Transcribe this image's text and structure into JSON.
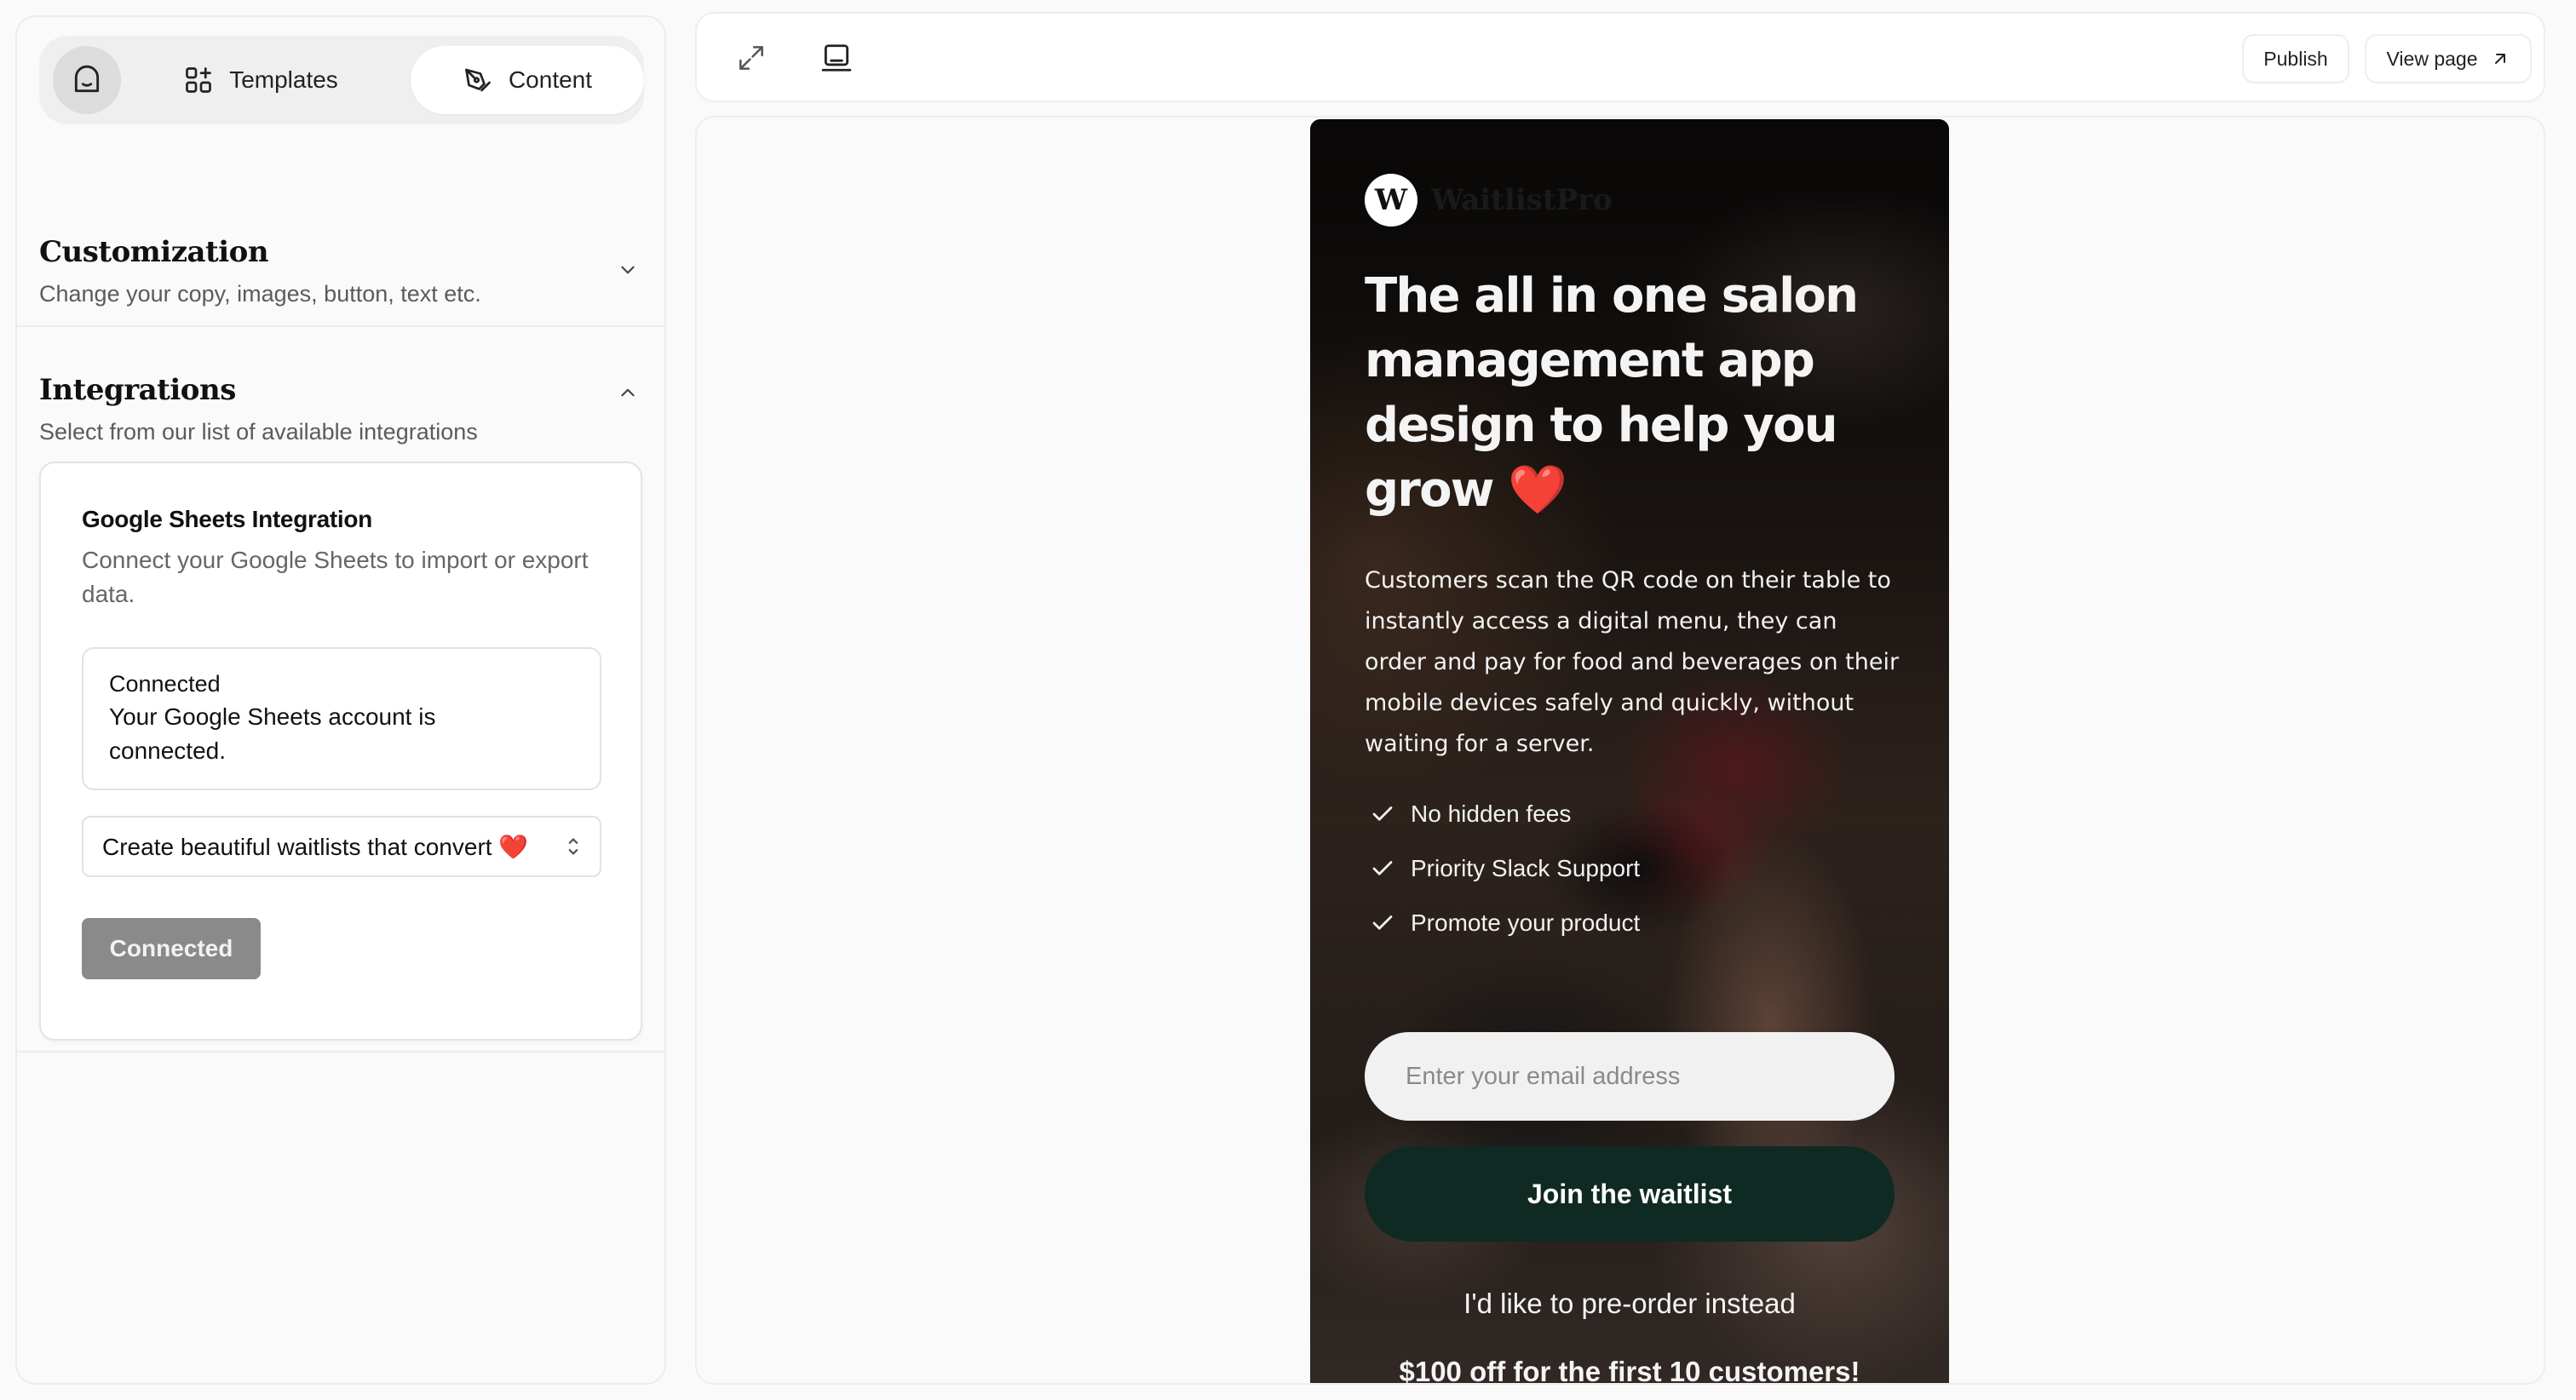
{
  "nav": {
    "templates_label": "Templates",
    "content_label": "Content"
  },
  "sections": {
    "customization": {
      "title": "Customization",
      "subtitle": "Change your copy, images, button, text etc.",
      "expanded": false
    },
    "integrations": {
      "title": "Integrations",
      "subtitle": "Select from our list of available integrations",
      "expanded": true
    }
  },
  "integration_card": {
    "title": "Google Sheets Integration",
    "description": "Connect your Google Sheets to import or export data.",
    "status_title": "Connected",
    "status_text": "Your Google Sheets account is connected.",
    "sheet_select_value": "Create beautiful waitlists that convert ❤️",
    "button_label": "Connected"
  },
  "toolbar": {
    "publish_label": "Publish",
    "view_page_label": "View page"
  },
  "preview": {
    "logo_letter": "W",
    "logo_text": "WaitlistPro",
    "headline": "The all in one salon management app design to help you grow ❤️",
    "body": "Customers scan the QR code on their table to instantly access a digital menu, they can order and pay for food and beverages on their mobile devices safely and quickly, without waiting for a server.",
    "features": [
      "No hidden fees",
      "Priority Slack Support",
      "Promote your product"
    ],
    "email_placeholder": "Enter your email address",
    "join_label": "Join the waitlist",
    "preorder_text": "I'd like to pre-order instead",
    "offer_text": "$100 off for the first 10 customers!"
  },
  "colors": {
    "join_button": "#0f2a22",
    "connected_button": "#8a8a8a"
  }
}
